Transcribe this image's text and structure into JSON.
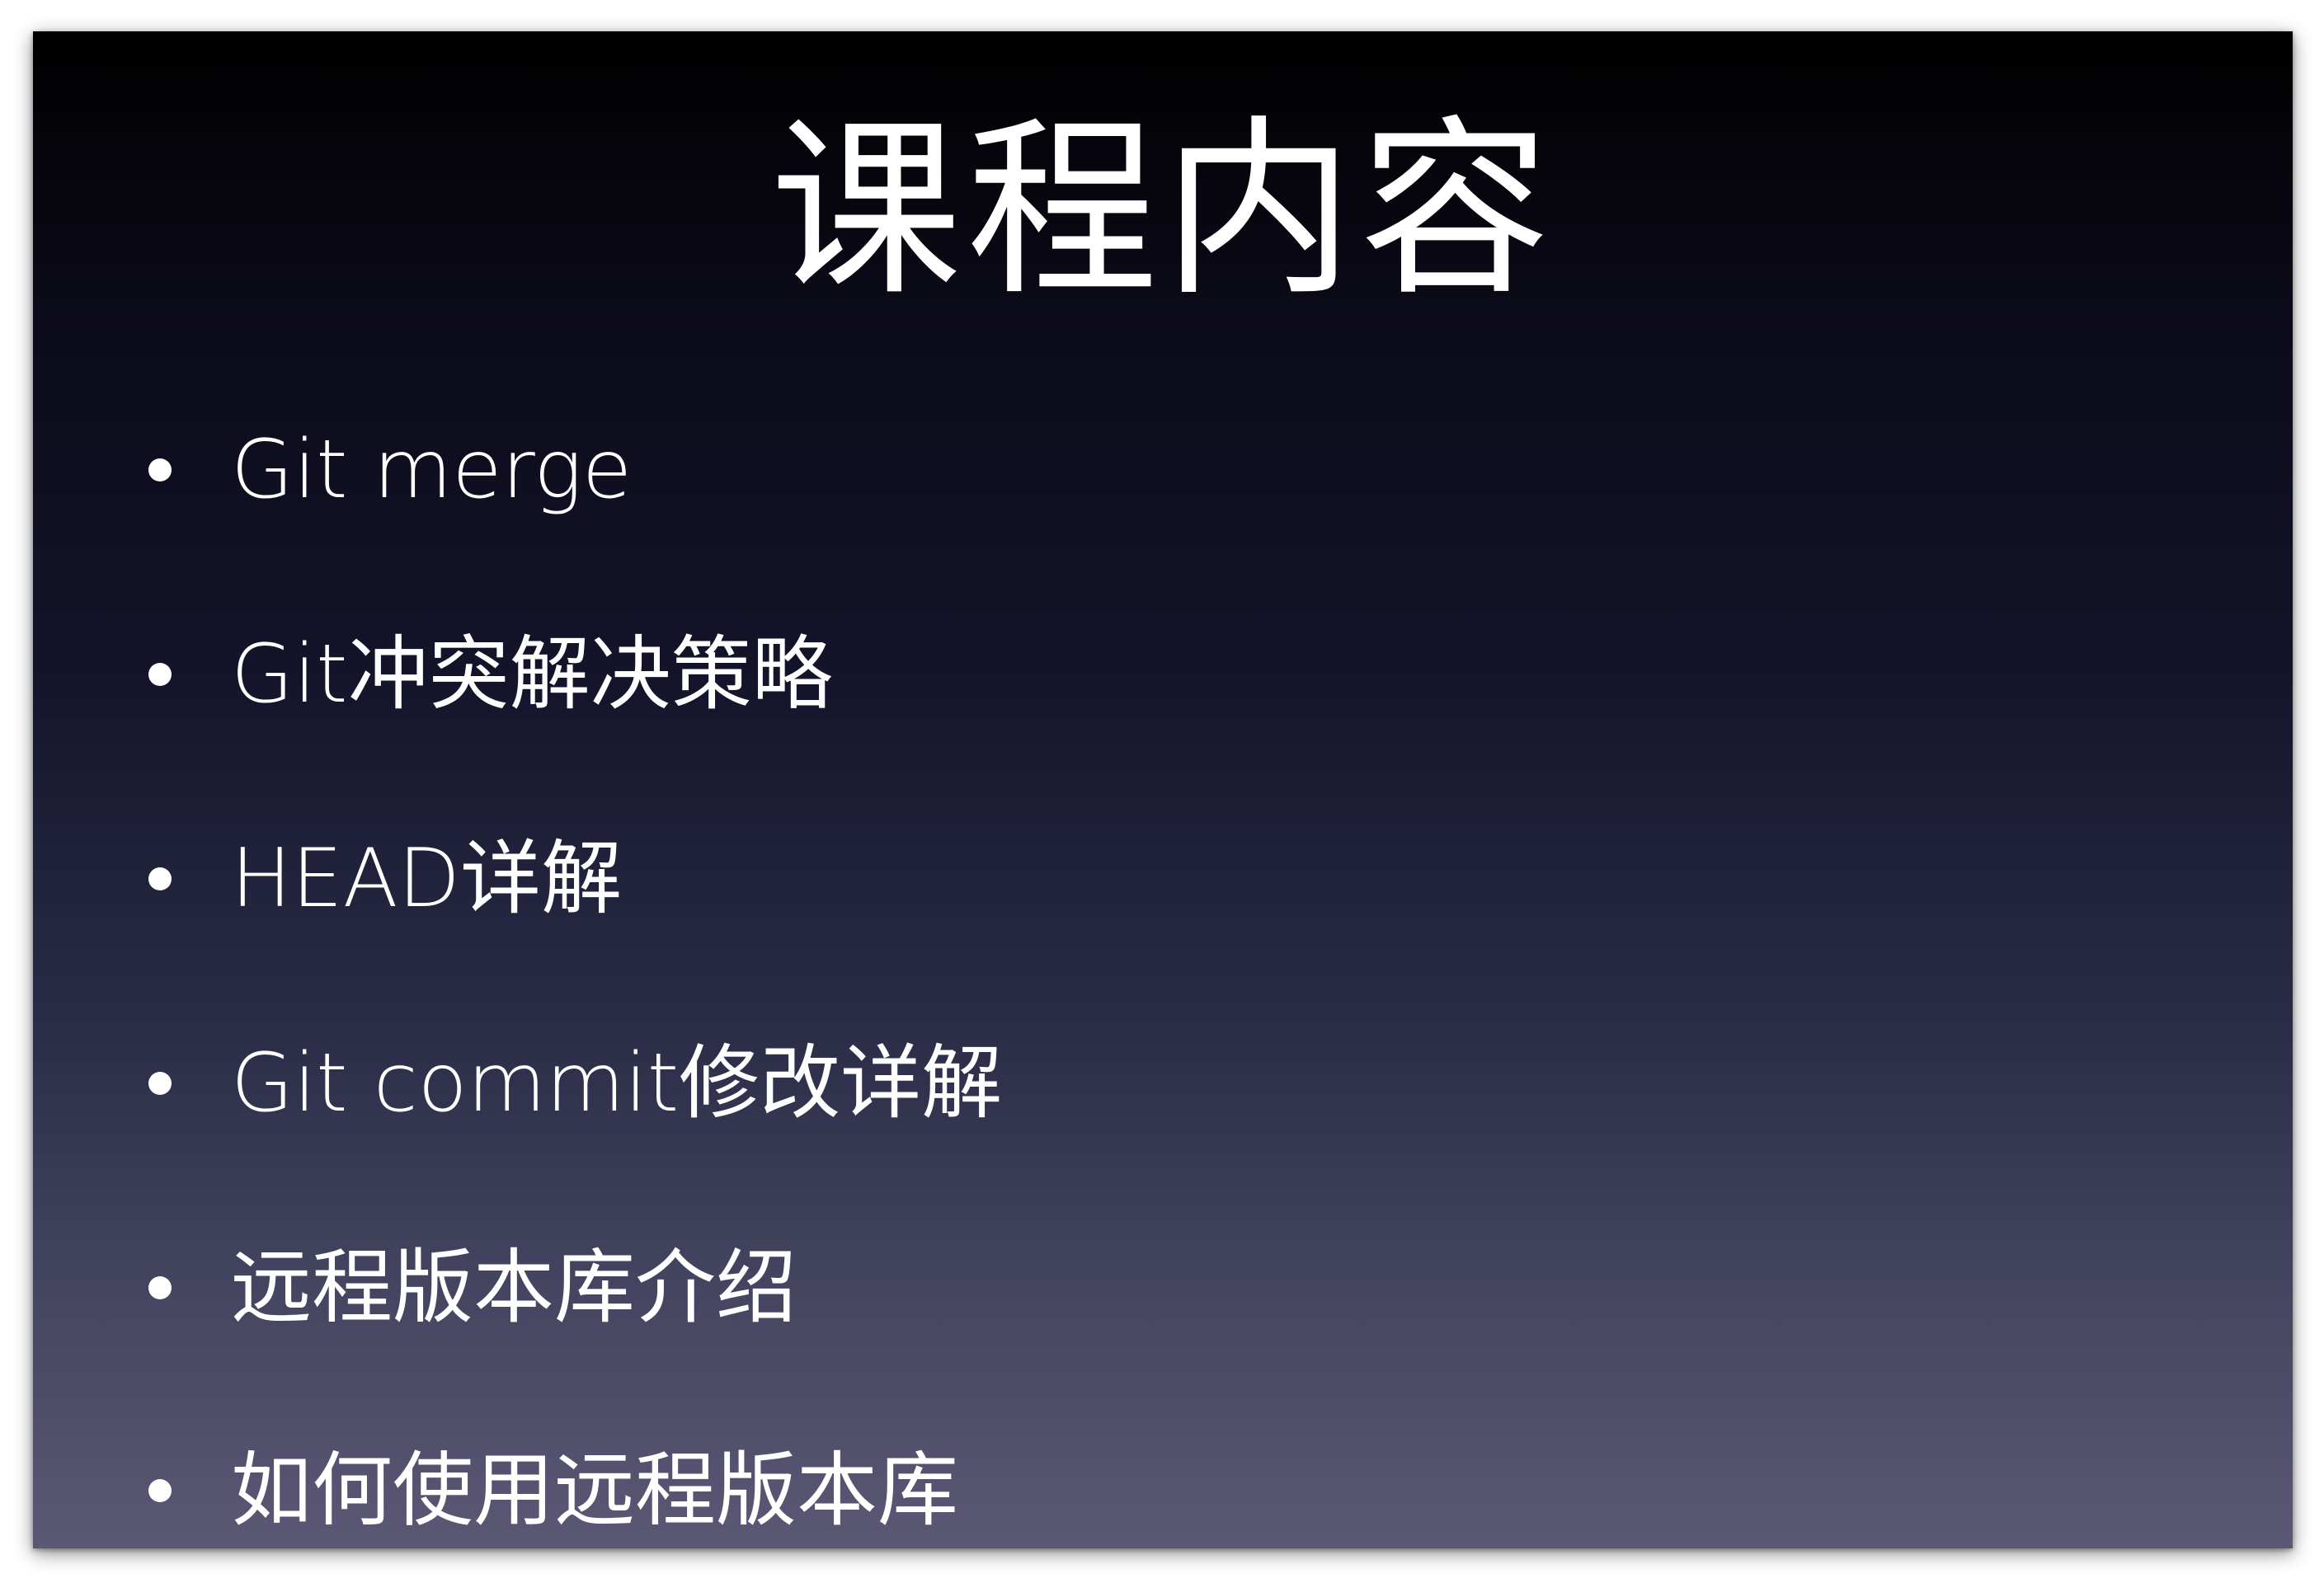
{
  "slide": {
    "title": "课程内容",
    "bullets": [
      "Git merge",
      "Git冲突解决策略",
      "HEAD详解",
      "Git commit修改详解",
      "远程版本库介绍",
      "如何使用远程版本库"
    ]
  },
  "colors": {
    "background_top": "#000000",
    "background_bottom": "#5b5875",
    "text": "#ffffff"
  }
}
